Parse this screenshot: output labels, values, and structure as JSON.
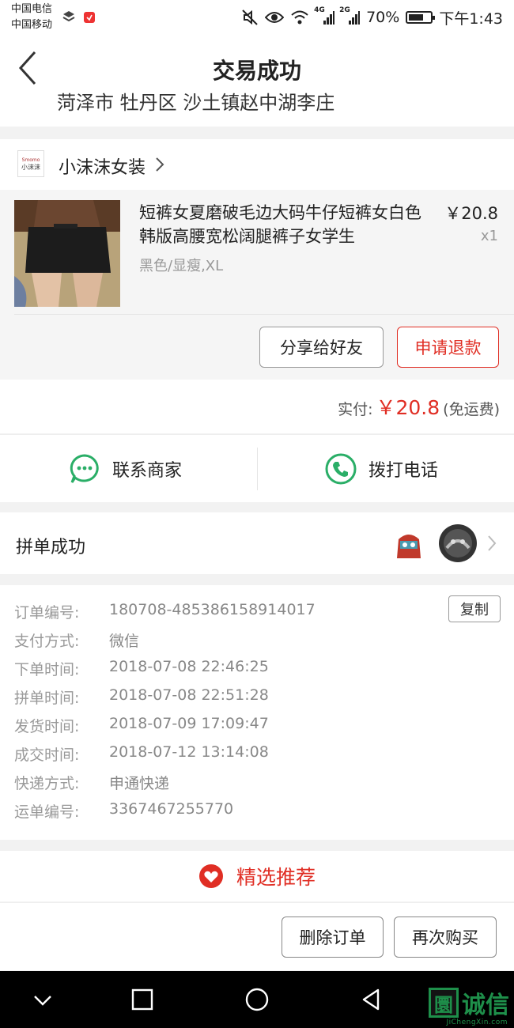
{
  "status_bar": {
    "carrier_1": "中国电信",
    "carrier_2": "中国移动",
    "network_1": "4G",
    "network_2": "2G",
    "battery_percent": "70%",
    "battery_level": 0.7,
    "time": "下午1:43"
  },
  "header": {
    "title": "交易成功",
    "address_peek": "菏泽市 牡丹区 沙土镇赵中湖李庄"
  },
  "shop": {
    "logo_text_top": "Smomo",
    "logo_text": "小沫沫",
    "name": "小沫沫女装"
  },
  "product": {
    "title": "短裤女夏磨破毛边大码牛仔短裤女白色韩版高腰宽松阔腿裤子女学生",
    "price": "￥20.8",
    "quantity": "x1",
    "sku": "黑色/显瘦,XL",
    "share_label": "分享给好友",
    "refund_label": "申请退款"
  },
  "payment": {
    "label": "实付:",
    "amount": "￥20.8",
    "note": "(免运费)"
  },
  "contact": {
    "merchant_label": "联系商家",
    "call_label": "拨打电话"
  },
  "group": {
    "label": "拼单成功"
  },
  "order_details": {
    "copy_label": "复制",
    "rows": [
      {
        "key": "订单编号:",
        "value": "180708-485386158914017"
      },
      {
        "key": "支付方式:",
        "value": "微信"
      },
      {
        "key": "下单时间:",
        "value": "2018-07-08 22:46:25"
      },
      {
        "key": "拼单时间:",
        "value": "2018-07-08 22:51:28"
      },
      {
        "key": "发货时间:",
        "value": "2018-07-09 17:09:47"
      },
      {
        "key": "成交时间:",
        "value": "2018-07-12 13:14:08"
      },
      {
        "key": "快递方式:",
        "value": "申通快递"
      },
      {
        "key": "运单编号:",
        "value": "3367467255770"
      }
    ]
  },
  "recommend": {
    "label": "精选推荐"
  },
  "actions": {
    "delete_label": "删除订单",
    "rebuy_label": "再次购买"
  },
  "watermark": {
    "box_char": "圜",
    "text": "诚信",
    "url": "JiChengXin.com"
  },
  "colors": {
    "accent_red": "#e02e24",
    "wechat_green": "#2aae67"
  }
}
